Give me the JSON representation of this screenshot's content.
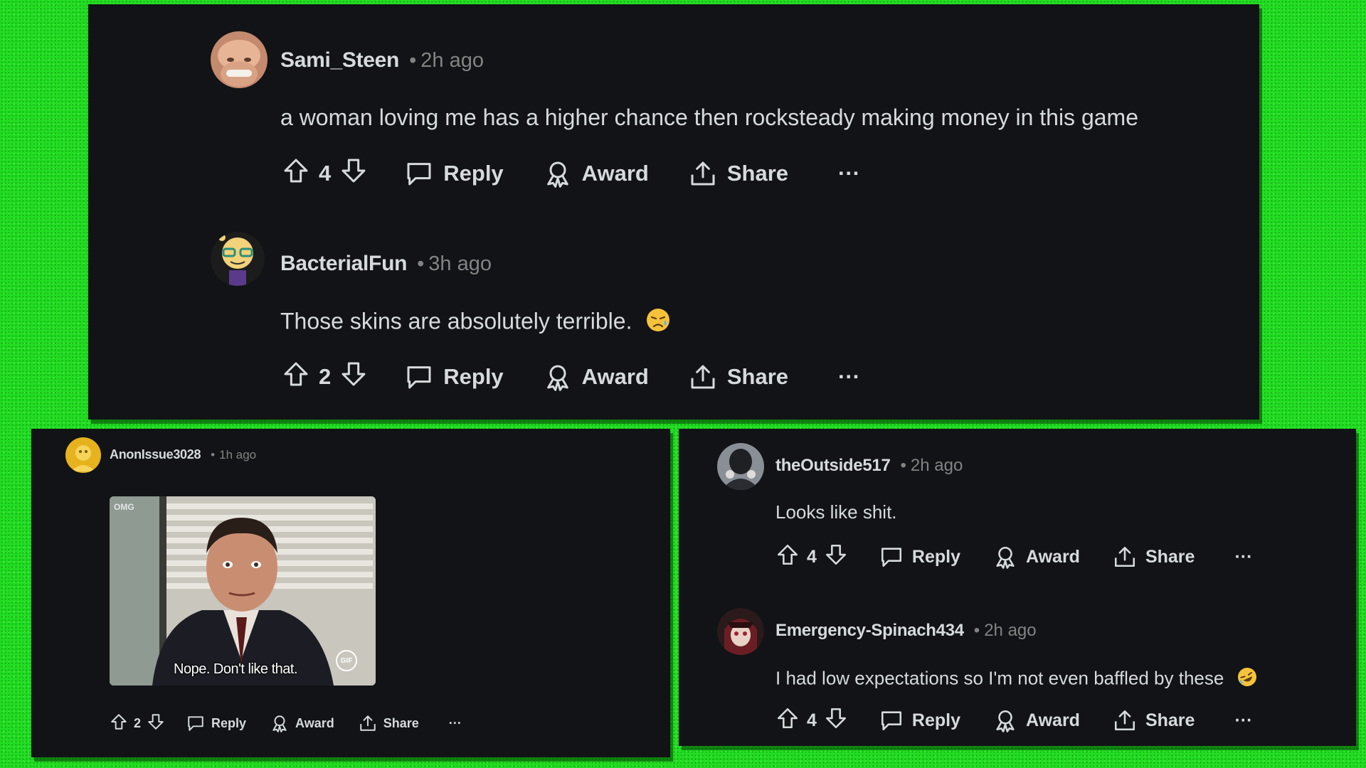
{
  "panels": {
    "top": {
      "comments": [
        {
          "username": "Sami_Steen",
          "time": "2h ago",
          "body": "a woman loving me has a higher chance then rocksteady making money in this game",
          "votes": "4",
          "reply": "Reply",
          "award": "Award",
          "share": "Share",
          "more": "···"
        },
        {
          "username": "BacterialFun",
          "time": "3h ago",
          "body": "Those skins are absolutely terrible.",
          "body_emoji": "sad-sweat-emoji",
          "votes": "2",
          "reply": "Reply",
          "award": "Award",
          "share": "Share",
          "more": "···"
        }
      ]
    },
    "bottom_left": {
      "comment": {
        "username": "AnonIssue3028",
        "time": "1h ago",
        "gif_caption": "Nope. Don't like that.",
        "gif_badge": "GIF",
        "gif_watermark": "OMG",
        "votes": "2",
        "reply": "Reply",
        "award": "Award",
        "share": "Share",
        "more": "···"
      }
    },
    "bottom_right": {
      "comments": [
        {
          "username": "theOutside517",
          "time": "2h ago",
          "body": "Looks like shit.",
          "votes": "4",
          "reply": "Reply",
          "award": "Award",
          "share": "Share",
          "more": "···"
        },
        {
          "username": "Emergency-Spinach434",
          "time": "2h ago",
          "body": "I had low expectations so I'm not even baffled by these",
          "body_emoji": "rofl-emoji",
          "votes": "4",
          "reply": "Reply",
          "award": "Award",
          "share": "Share",
          "more": "···"
        }
      ]
    }
  },
  "colors": {
    "background": "#22dd22",
    "panel": "#111316",
    "text": "#d7dadc",
    "muted": "#818384"
  }
}
